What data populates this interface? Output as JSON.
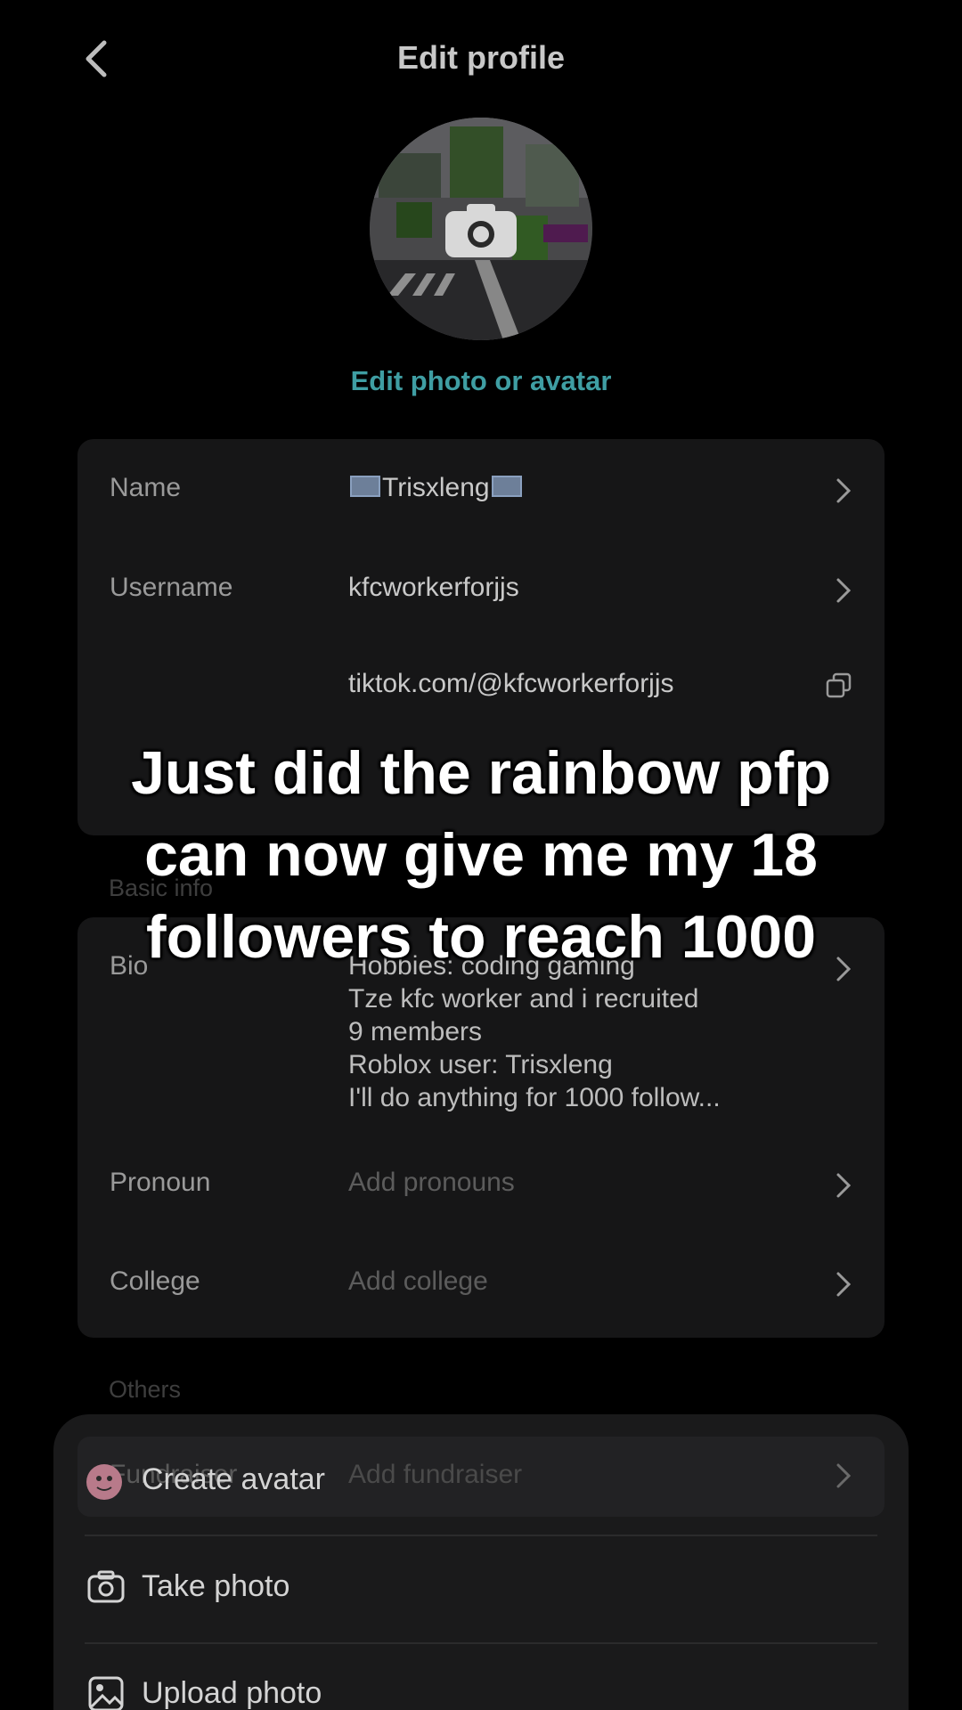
{
  "header": {
    "title": "Edit profile"
  },
  "avatar": {
    "edit_label": "Edit photo or avatar"
  },
  "profile": {
    "name_label": "Name",
    "name_value": "Trisxleng",
    "username_label": "Username",
    "username_value": "kfcworkerforjjs",
    "link_value": "tiktok.com/@kfcworkerforjjs"
  },
  "basic": {
    "section_label": "Basic info",
    "bio_label": "Bio",
    "bio_lines": [
      "Hobbies: coding gaming",
      "Tze kfc worker and i recruited",
      "9 members",
      "Roblox user: Trisxleng",
      "I'll do anything for 1000 follow..."
    ],
    "pronoun_label": "Pronoun",
    "pronoun_placeholder": "Add pronouns",
    "college_label": "College",
    "college_placeholder": "Add college"
  },
  "others": {
    "section_label": "Others",
    "fundraiser_label": "Fundraiser",
    "fundraiser_placeholder": "Add fundraiser"
  },
  "sheet": {
    "create_avatar": "Create avatar",
    "take_photo": "Take photo",
    "upload_photo": "Upload photo"
  },
  "overlay": {
    "caption_lines": [
      "Just did the rainbow pfp",
      "can now give me my 18",
      "followers to reach 1000"
    ]
  },
  "colors": {
    "accent": "#3f9ea3",
    "card": "#161617",
    "background": "#000000"
  }
}
